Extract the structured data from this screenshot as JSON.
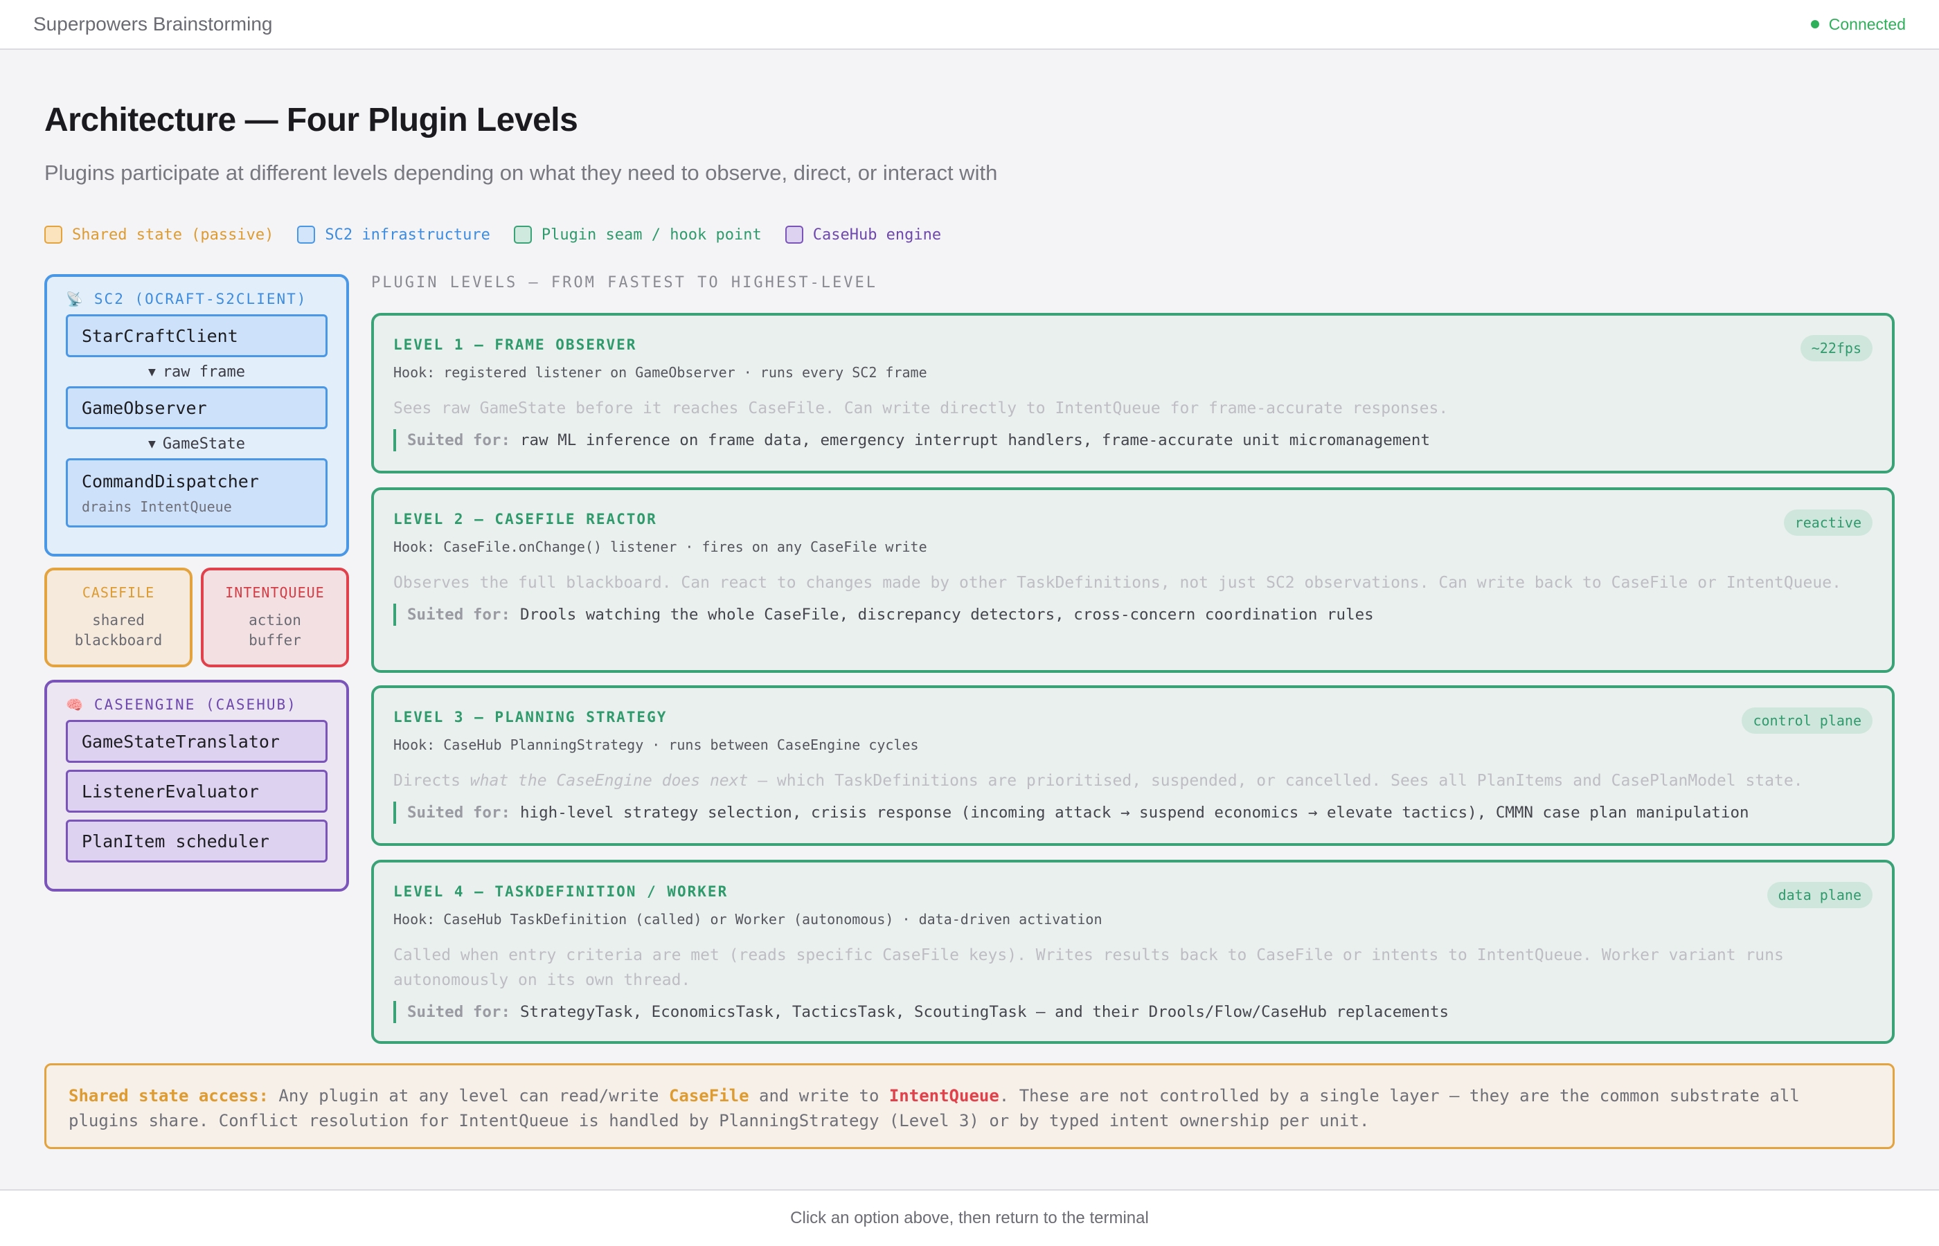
{
  "topbar": {
    "title": "Superpowers Brainstorming",
    "status": "Connected"
  },
  "header": {
    "title": "Architecture — Four Plugin Levels",
    "subtitle": "Plugins participate at different levels depending on what they need to observe, direct, or interact with"
  },
  "legend": [
    {
      "label": "Shared state (passive)"
    },
    {
      "label": "SC2 infrastructure"
    },
    {
      "label": "Plugin seam / hook point"
    },
    {
      "label": "CaseHub engine"
    }
  ],
  "sc2": {
    "title": "SC2 (OCRAFT-S2CLIENT)",
    "nodes": [
      {
        "label": "StarCraftClient"
      },
      {
        "label": "GameObserver"
      },
      {
        "label": "CommandDispatcher",
        "sub": "drains IntentQueue"
      }
    ],
    "arrows": [
      "raw frame",
      "GameState"
    ]
  },
  "casefile": {
    "title": "CASEFILE",
    "line1": "shared",
    "line2": "blackboard"
  },
  "intentqueue": {
    "title": "INTENTQUEUE",
    "line1": "action",
    "line2": "buffer"
  },
  "caseengine": {
    "title": "CASEENGINE (CASEHUB)",
    "nodes": [
      {
        "label": "GameStateTranslator"
      },
      {
        "label": "ListenerEvaluator"
      },
      {
        "label": "PlanItem scheduler"
      }
    ]
  },
  "levels_label": "PLUGIN LEVELS — FROM FASTEST TO HIGHEST-LEVEL",
  "suited_label": "Suited for:",
  "levels": [
    {
      "title": "LEVEL 1 — FRAME OBSERVER",
      "badge": "~22fps",
      "hook": "Hook: registered listener on GameObserver · runs every SC2 frame",
      "desc": "Sees raw GameState before it reaches CaseFile. Can write directly to IntentQueue for frame-accurate responses.",
      "suited": "raw ML inference on frame data, emergency interrupt handlers, frame-accurate unit micromanagement"
    },
    {
      "title": "LEVEL 2 — CASEFILE REACTOR",
      "badge": "reactive",
      "hook": "Hook: CaseFile.onChange() listener · fires on any CaseFile write",
      "desc": "Observes the full blackboard. Can react to changes made by other TaskDefinitions, not just SC2 observations. Can write back to CaseFile or IntentQueue.",
      "suited": "Drools watching the whole CaseFile, discrepancy detectors, cross-concern coordination rules"
    },
    {
      "title": "LEVEL 3 — PLANNING STRATEGY",
      "badge": "control plane",
      "hook": "Hook: CaseHub PlanningStrategy · runs between CaseEngine cycles",
      "desc_pre": "Directs ",
      "desc_em": "what the CaseEngine does next",
      "desc_post": " — which TaskDefinitions are prioritised, suspended, or cancelled. Sees all PlanItems and CasePlanModel state.",
      "suited": "high-level strategy selection, crisis response (incoming attack → suspend economics → elevate tactics), CMMN case plan manipulation"
    },
    {
      "title": "LEVEL 4 — TASKDEFINITION / WORKER",
      "badge": "data plane",
      "hook": "Hook: CaseHub TaskDefinition (called) or Worker (autonomous) · data-driven activation",
      "desc": "Called when entry criteria are met (reads specific CaseFile keys). Writes results back to CaseFile or intents to IntentQueue. Worker variant runs autonomously on its own thread.",
      "suited": "StrategyTask, EconomicsTask, TacticsTask, ScoutingTask — and their Drools/Flow/CaseHub replacements"
    }
  ],
  "note": {
    "key": "Shared state access:",
    "t1": " Any plugin at any level can read/write ",
    "cf": "CaseFile",
    "t2": " and write to ",
    "iq": "IntentQueue",
    "t3": ". These are not controlled by a single layer — they are the common substrate all plugins share. Conflict resolution for IntentQueue is handled by PlanningStrategy (Level 3) or by typed intent ownership per unit."
  },
  "footer": {
    "text": "Click an option above, then return to the terminal"
  },
  "icons": {
    "sc2": "satellite-dish-icon",
    "casehub": "brain-icon"
  }
}
